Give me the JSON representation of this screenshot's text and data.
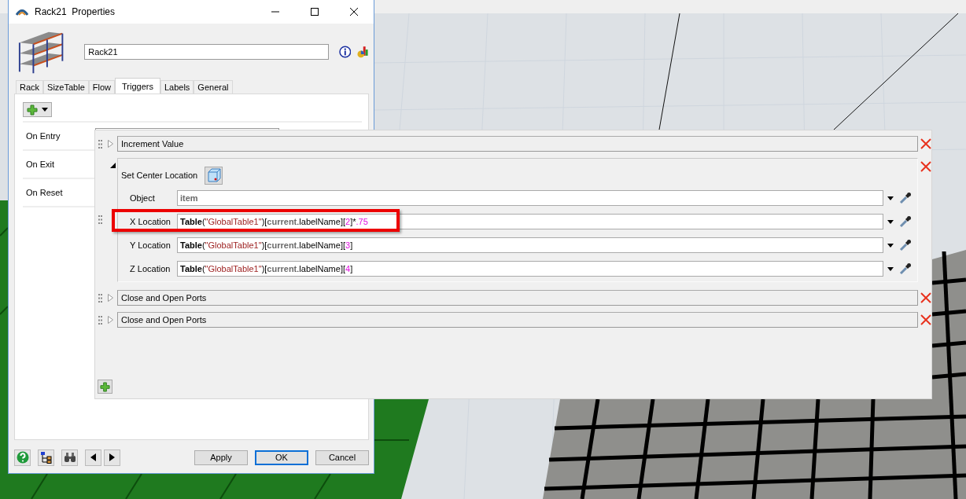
{
  "window": {
    "title": "Rack21  Properties",
    "object_name": "Rack21"
  },
  "tabs": [
    {
      "label": "Rack",
      "selected": false
    },
    {
      "label": "SizeTable",
      "selected": false
    },
    {
      "label": "Flow",
      "selected": false
    },
    {
      "label": "Triggers",
      "selected": true
    },
    {
      "label": "Labels",
      "selected": false
    },
    {
      "label": "General",
      "selected": false
    }
  ],
  "triggers": [
    {
      "label": "On Entry"
    },
    {
      "label": "On Exit"
    },
    {
      "label": "On Reset"
    }
  ],
  "popup": {
    "items": [
      {
        "title": "Increment Value",
        "expanded": false
      },
      {
        "title": "Set Center Location",
        "expanded": true,
        "params": [
          {
            "label": "Object",
            "highlighted": false,
            "tokens": [
              {
                "text": "item",
                "kind": "var"
              }
            ]
          },
          {
            "label": "X Location",
            "highlighted": true,
            "tokens": [
              {
                "text": "Table",
                "kind": "keyword"
              },
              {
                "text": "(",
                "kind": "punct"
              },
              {
                "text": "\"GlobalTable1\"",
                "kind": "string"
              },
              {
                "text": ")[",
                "kind": "punct"
              },
              {
                "text": "current",
                "kind": "var"
              },
              {
                "text": ".labelName][",
                "kind": "punct"
              },
              {
                "text": "2",
                "kind": "number"
              },
              {
                "text": "]*",
                "kind": "punct"
              },
              {
                "text": ".75",
                "kind": "number"
              }
            ]
          },
          {
            "label": "Y Location",
            "highlighted": false,
            "tokens": [
              {
                "text": "Table",
                "kind": "keyword"
              },
              {
                "text": "(",
                "kind": "punct"
              },
              {
                "text": "\"GlobalTable1\"",
                "kind": "string"
              },
              {
                "text": ")[",
                "kind": "punct"
              },
              {
                "text": "current",
                "kind": "var"
              },
              {
                "text": ".labelName][",
                "kind": "punct"
              },
              {
                "text": "3",
                "kind": "number"
              },
              {
                "text": "]",
                "kind": "punct"
              }
            ]
          },
          {
            "label": "Z Location",
            "highlighted": false,
            "tokens": [
              {
                "text": "Table",
                "kind": "keyword"
              },
              {
                "text": "(",
                "kind": "punct"
              },
              {
                "text": "\"GlobalTable1\"",
                "kind": "string"
              },
              {
                "text": ")[",
                "kind": "punct"
              },
              {
                "text": "current",
                "kind": "var"
              },
              {
                "text": ".labelName][",
                "kind": "punct"
              },
              {
                "text": "4",
                "kind": "number"
              },
              {
                "text": "]",
                "kind": "punct"
              }
            ]
          }
        ]
      },
      {
        "title": "Close and Open Ports",
        "expanded": false
      },
      {
        "title": "Close and Open Ports",
        "expanded": false
      }
    ]
  },
  "buttons": [
    {
      "label": "Apply",
      "default": false
    },
    {
      "label": "OK",
      "default": true
    },
    {
      "label": "Cancel",
      "default": false
    }
  ]
}
